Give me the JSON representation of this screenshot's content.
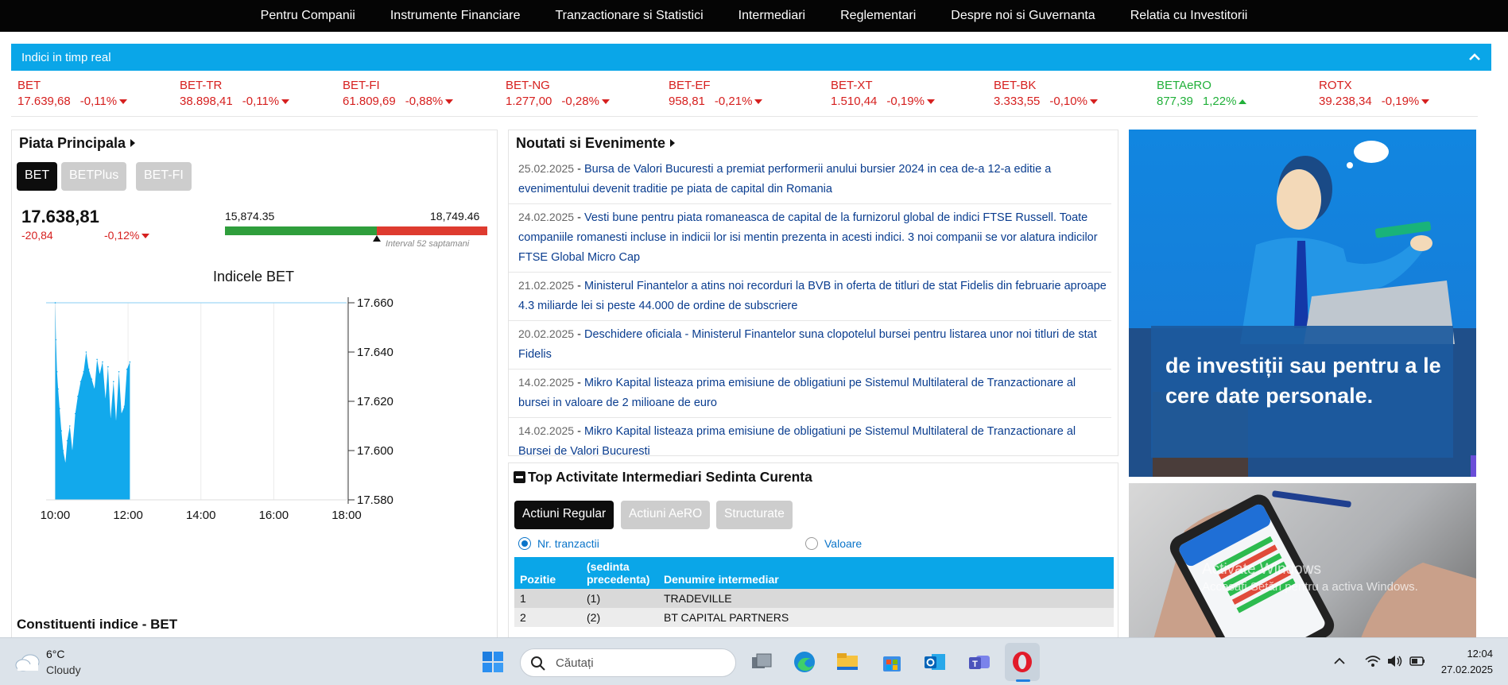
{
  "nav": [
    "Pentru Companii",
    "Instrumente Financiare",
    "Tranzactionare si Statistici",
    "Intermediari",
    "Reglementari",
    "Despre noi si Guvernanta",
    "Relatia cu Investitorii"
  ],
  "ribbon": {
    "title": "Indici in timp real"
  },
  "indices": [
    {
      "name": "BET",
      "value": "17.639,68",
      "change": "-0,11%",
      "dir": "down"
    },
    {
      "name": "BET-TR",
      "value": "38.898,41",
      "change": "-0,11%",
      "dir": "down"
    },
    {
      "name": "BET-FI",
      "value": "61.809,69",
      "change": "-0,88%",
      "dir": "down"
    },
    {
      "name": "BET-NG",
      "value": "1.277,00",
      "change": "-0,28%",
      "dir": "down"
    },
    {
      "name": "BET-EF",
      "value": "958,81",
      "change": "-0,21%",
      "dir": "down"
    },
    {
      "name": "BET-XT",
      "value": "1.510,44",
      "change": "-0,19%",
      "dir": "down"
    },
    {
      "name": "BET-BK",
      "value": "3.333,55",
      "change": "-0,10%",
      "dir": "down"
    },
    {
      "name": "BETAeRO",
      "value": "877,39",
      "change": "1,22%",
      "dir": "up"
    },
    {
      "name": "ROTX",
      "value": "39.238,34",
      "change": "-0,19%",
      "dir": "down"
    }
  ],
  "piata": {
    "title": "Piata Principala",
    "tabs": [
      "BET",
      "BETPlus",
      "BET-FI"
    ],
    "value": "17.638,81",
    "abs_change": "-20,84",
    "pct_change": "-0,12%",
    "range_low": "15,874.35",
    "range_high": "18,749.46",
    "range_position": 0.58,
    "range_label": "Interval 52 saptamani",
    "constituents_title": "Constituenti indice - BET"
  },
  "chart_data": {
    "type": "area",
    "title": "Indicele BET",
    "x_ticks": [
      "10:00",
      "12:00",
      "14:00",
      "16:00",
      "18:00"
    ],
    "y_ticks": [
      "17.660",
      "17.640",
      "17.620",
      "17.600",
      "17.580"
    ],
    "ylim": [
      17580,
      17660
    ],
    "xlim_hours": [
      9.75,
      18.0
    ],
    "color": "#12a9ec",
    "x_hours": [
      10.0,
      10.02,
      10.05,
      10.08,
      10.12,
      10.17,
      10.22,
      10.28,
      10.33,
      10.4,
      10.47,
      10.55,
      10.62,
      10.7,
      10.78,
      10.85,
      10.92,
      11.0,
      11.08,
      11.15,
      11.22,
      11.3,
      11.38,
      11.45,
      11.52,
      11.6,
      11.67,
      11.75,
      11.82,
      11.9,
      11.97,
      12.05
    ],
    "y": [
      17660,
      17645,
      17632,
      17625,
      17617,
      17608,
      17600,
      17595,
      17604,
      17610,
      17600,
      17615,
      17622,
      17628,
      17632,
      17640,
      17633,
      17629,
      17625,
      17637,
      17631,
      17636,
      17621,
      17634,
      17613,
      17628,
      17612,
      17632,
      17615,
      17618,
      17633,
      17636
    ]
  },
  "news": {
    "title": "Noutati si Evenimente",
    "items": [
      {
        "date": "25.02.2025",
        "text": "Bursa de Valori Bucuresti a premiat performerii anului bursier 2024 in cea de-a 12-a editie a evenimentului devenit traditie pe piata de capital din Romania"
      },
      {
        "date": "24.02.2025",
        "text": "Vesti bune pentru piata romaneasca de capital de la furnizorul global de indici FTSE Russell. Toate companiile romanesti incluse in indicii lor isi mentin prezenta in acesti indici. 3 noi companii se vor alatura indicilor FTSE Global Micro Cap"
      },
      {
        "date": "21.02.2025",
        "text": "Ministerul Finantelor a atins noi recorduri la BVB in oferta de titluri de stat Fidelis din februarie aproape 4.3 miliarde lei si peste 44.000 de ordine de subscriere"
      },
      {
        "date": "20.02.2025",
        "text": "Deschidere oficiala - Ministerul Finantelor suna clopotelul bursei pentru listarea unor noi titluri de stat Fidelis"
      },
      {
        "date": "14.02.2025",
        "text": "Mikro Kapital listeaza prima emisiune de obligatiuni pe Sistemul Multilateral de Tranzactionare al bursei in valoare de 2 milioane de euro"
      },
      {
        "date": "14.02.2025",
        "text": "Mikro Kapital listeaza prima emisiune de obligatiuni pe Sistemul Multilateral de Tranzactionare al Bursei de Valori Bucuresti"
      }
    ]
  },
  "intermediari": {
    "title": "Top Activitate Intermediari Sedinta Curenta",
    "tabs": [
      "Actiuni Regular",
      "Actiuni AeRO",
      "Structurate"
    ],
    "radio": [
      "Nr. tranzactii",
      "Valoare"
    ],
    "headers": [
      "Pozitie",
      "(sedinta precedenta)",
      "Denumire intermediar"
    ],
    "rows": [
      [
        "1",
        "(1)",
        "TRADEVILLE"
      ],
      [
        "2",
        "(2)",
        "BT CAPITAL PARTNERS"
      ]
    ]
  },
  "ads": {
    "ad1_text": "de investiții sau pentru a le cere date personale.",
    "watermark_line1": "Activate Windows",
    "watermark_line2": "Accesați Setări pentru a activa Windows."
  },
  "taskbar": {
    "temp": "6°C",
    "weather": "Cloudy",
    "search_placeholder": "Căutați",
    "time": "12:04",
    "date": "27.02.2025"
  },
  "colors": {
    "accent": "#0aa6e8",
    "down": "#d6201f",
    "up": "#21b03a",
    "link": "#0a3d8f"
  }
}
